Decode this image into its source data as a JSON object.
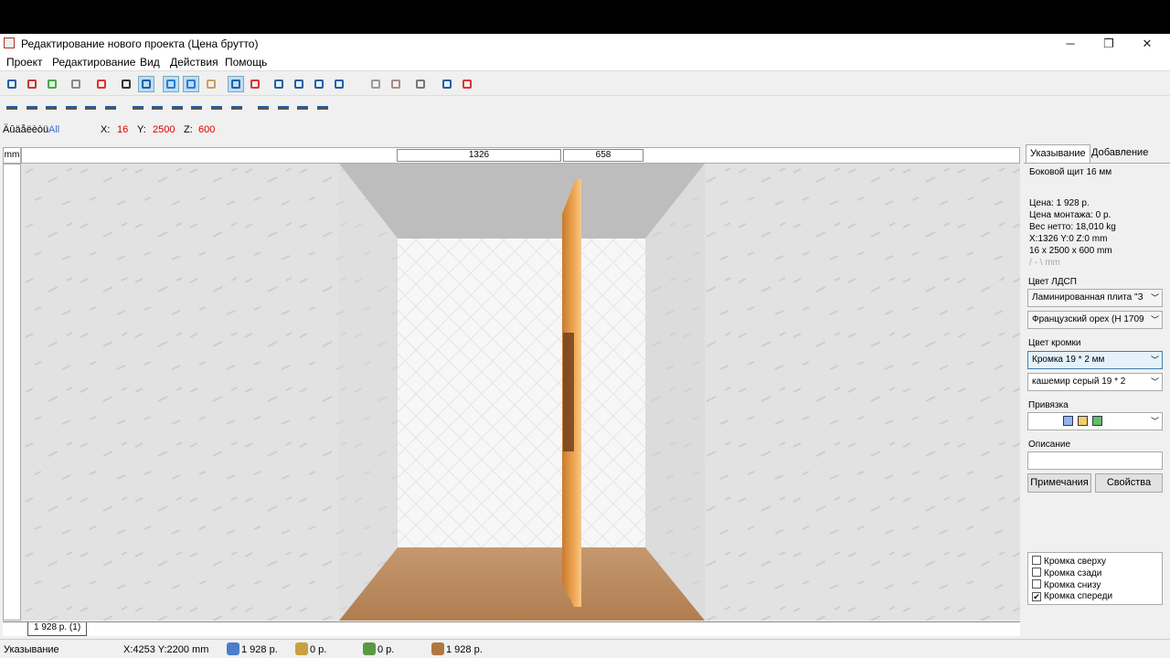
{
  "window": {
    "title": "Редактирование нового проекта (Цена брутто)",
    "minimize": "─",
    "restore": "❐",
    "close": "✕"
  },
  "menu": [
    "Проект",
    "Редактирование",
    "Вид",
    "Действия",
    "Помощь"
  ],
  "coords": {
    "mode_label": "Äûäåëèòü",
    "mode_value": "All",
    "x_label": "X:",
    "x": "16",
    "y_label": "Y:",
    "y": "2500",
    "z_label": "Z:",
    "z": "600"
  },
  "ruler": {
    "unit": "mm",
    "dim1": "1326",
    "dim2": "658"
  },
  "tab": {
    "label": "1 928 р. (1)"
  },
  "status": {
    "mode": "Указывание",
    "pos": "X:4253  Y:2200  mm",
    "price1": "1 928 р.",
    "price2": "0 р.",
    "price3": "0 р.",
    "price4": "1 928 р."
  },
  "panel": {
    "tab_select": "Указывание",
    "tab_add": "Добавление",
    "object": "Боковой щит 16 мм",
    "price": "Цена:  1 928 р.",
    "install": "Цена монтажа:  0 р.",
    "weight": "Вес нетто:  18,010 kg",
    "position": "X:1326  Y:0  Z:0 mm",
    "size": "16 x 2500 x 600 mm",
    "dims_hint": "/ - \\ mm",
    "color_label": "Цвет ЛДСП",
    "color_type": "Ламинированная плита \"З",
    "color_value": "Французский орех (Н 1709",
    "edge_label": "Цвет кромки",
    "edge_type": "Кромка 19 * 2 мм",
    "edge_value": "кашемир серый 19 * 2",
    "snap_label": "Привязка",
    "desc_label": "Описание",
    "desc_value": "",
    "notes_btn": "Примечания",
    "props_btn": "Свойства",
    "checks": [
      {
        "label": "Кромка сверху",
        "checked": false
      },
      {
        "label": "Кромка сзади",
        "checked": false
      },
      {
        "label": "Кромка снизу",
        "checked": false
      },
      {
        "label": "Кромка спереди",
        "checked": true
      }
    ]
  },
  "toolbar1_icons": [
    "save-icon",
    "open-icon",
    "new-icon",
    "print-icon",
    "delete-icon",
    "view-2d-icon",
    "view-front-icon",
    "grid-icon",
    "frame-icon",
    "panel-icon",
    "corner-icon",
    "cut-icon",
    "zoom-in-icon",
    "zoom-out-icon",
    "zoom-fit-icon",
    "zoom-icon",
    "box-icon",
    "boxes-icon",
    "sphere-icon",
    "wand-icon",
    "eraser-icon"
  ],
  "toolbar2_icons": [
    "align-left-icon",
    "align-right-icon",
    "align-top-icon",
    "align-bottom-icon",
    "rotate-icon",
    "mirror-icon",
    "move-left-icon",
    "move-right-icon",
    "move-up-icon",
    "move-down-icon",
    "copy-icon",
    "paint-icon",
    "distribute-h-icon",
    "distribute-v-icon",
    "space-h-icon",
    "space-v-icon"
  ],
  "colors": {
    "accent": "#3a6fd8",
    "wall": "#e4e4e4",
    "floor": "#b98a5c",
    "panel": "#e9a24f",
    "ceiling": "#bdbdbd"
  }
}
